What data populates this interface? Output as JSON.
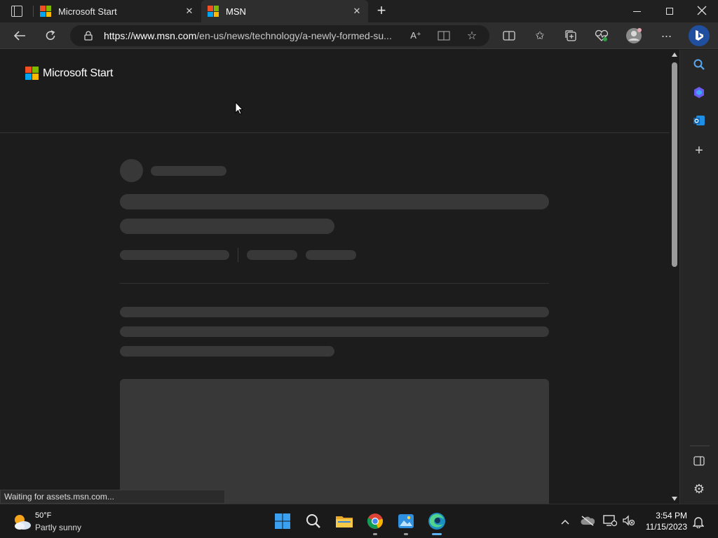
{
  "browser": {
    "tabs": [
      {
        "title": "Microsoft Start",
        "close": "✕"
      },
      {
        "title": "MSN",
        "close": "✕"
      }
    ],
    "new_tab": "+",
    "url_host": "https://www.msn.com",
    "url_path": "/en-us/news/technology/a-newly-formed-su..."
  },
  "page": {
    "brand": "Microsoft Start"
  },
  "status_text": "Waiting for assets.msn.com...",
  "taskbar": {
    "weather_temp": "50°F",
    "weather_desc": "Partly sunny",
    "time": "3:54 PM",
    "date": "11/15/2023"
  },
  "colors": {
    "ms_red": "#f25022",
    "ms_green": "#7fba00",
    "ms_blue": "#00a4ef",
    "ms_yellow": "#ffb900",
    "skeleton": "#383838"
  }
}
